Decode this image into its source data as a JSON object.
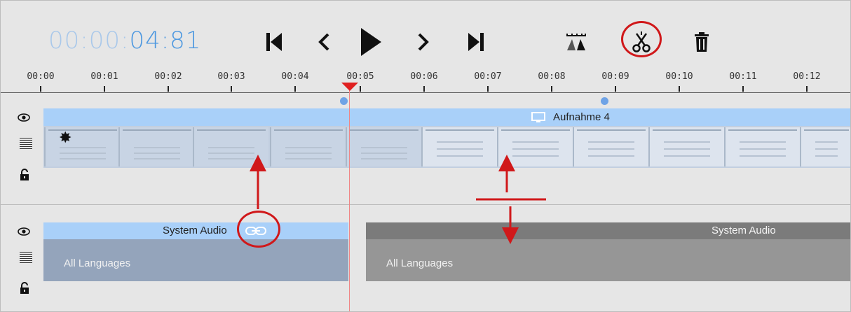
{
  "timecode": {
    "dim": "00:00:",
    "bright": "04:81"
  },
  "toolbar": {
    "buttons": [
      {
        "name": "skip-to-start",
        "icon": "skip-start-icon"
      },
      {
        "name": "previous-frame",
        "icon": "chevron-left-icon"
      },
      {
        "name": "play",
        "icon": "play-icon"
      },
      {
        "name": "next-frame",
        "icon": "chevron-right-icon"
      },
      {
        "name": "skip-to-end",
        "icon": "skip-end-icon"
      },
      {
        "name": "snap",
        "icon": "ruler-marker-icon"
      },
      {
        "name": "split",
        "icon": "scissors-icon"
      },
      {
        "name": "delete",
        "icon": "trash-icon"
      }
    ]
  },
  "ruler": {
    "labels": [
      "00:00",
      "00:01",
      "00:02",
      "00:03",
      "00:04",
      "00:05",
      "00:06",
      "00:07",
      "00:08",
      "00:09",
      "00:10",
      "00:11",
      "00:12"
    ]
  },
  "video_track": {
    "title": "Aufnahme 4",
    "icon": "monitor-icon"
  },
  "audio_track": {
    "clip1": {
      "title": "System Audio",
      "language": "All Languages",
      "icon": "link-icon"
    },
    "clip2": {
      "title": "System Audio",
      "language": "All Languages"
    }
  },
  "colors": {
    "accent": "#4d98e0",
    "annotation": "#d0181a",
    "video_header": "#a9d0f9",
    "audio_clip_selected": "#94a4bb",
    "audio_clip_other": "#969696"
  }
}
